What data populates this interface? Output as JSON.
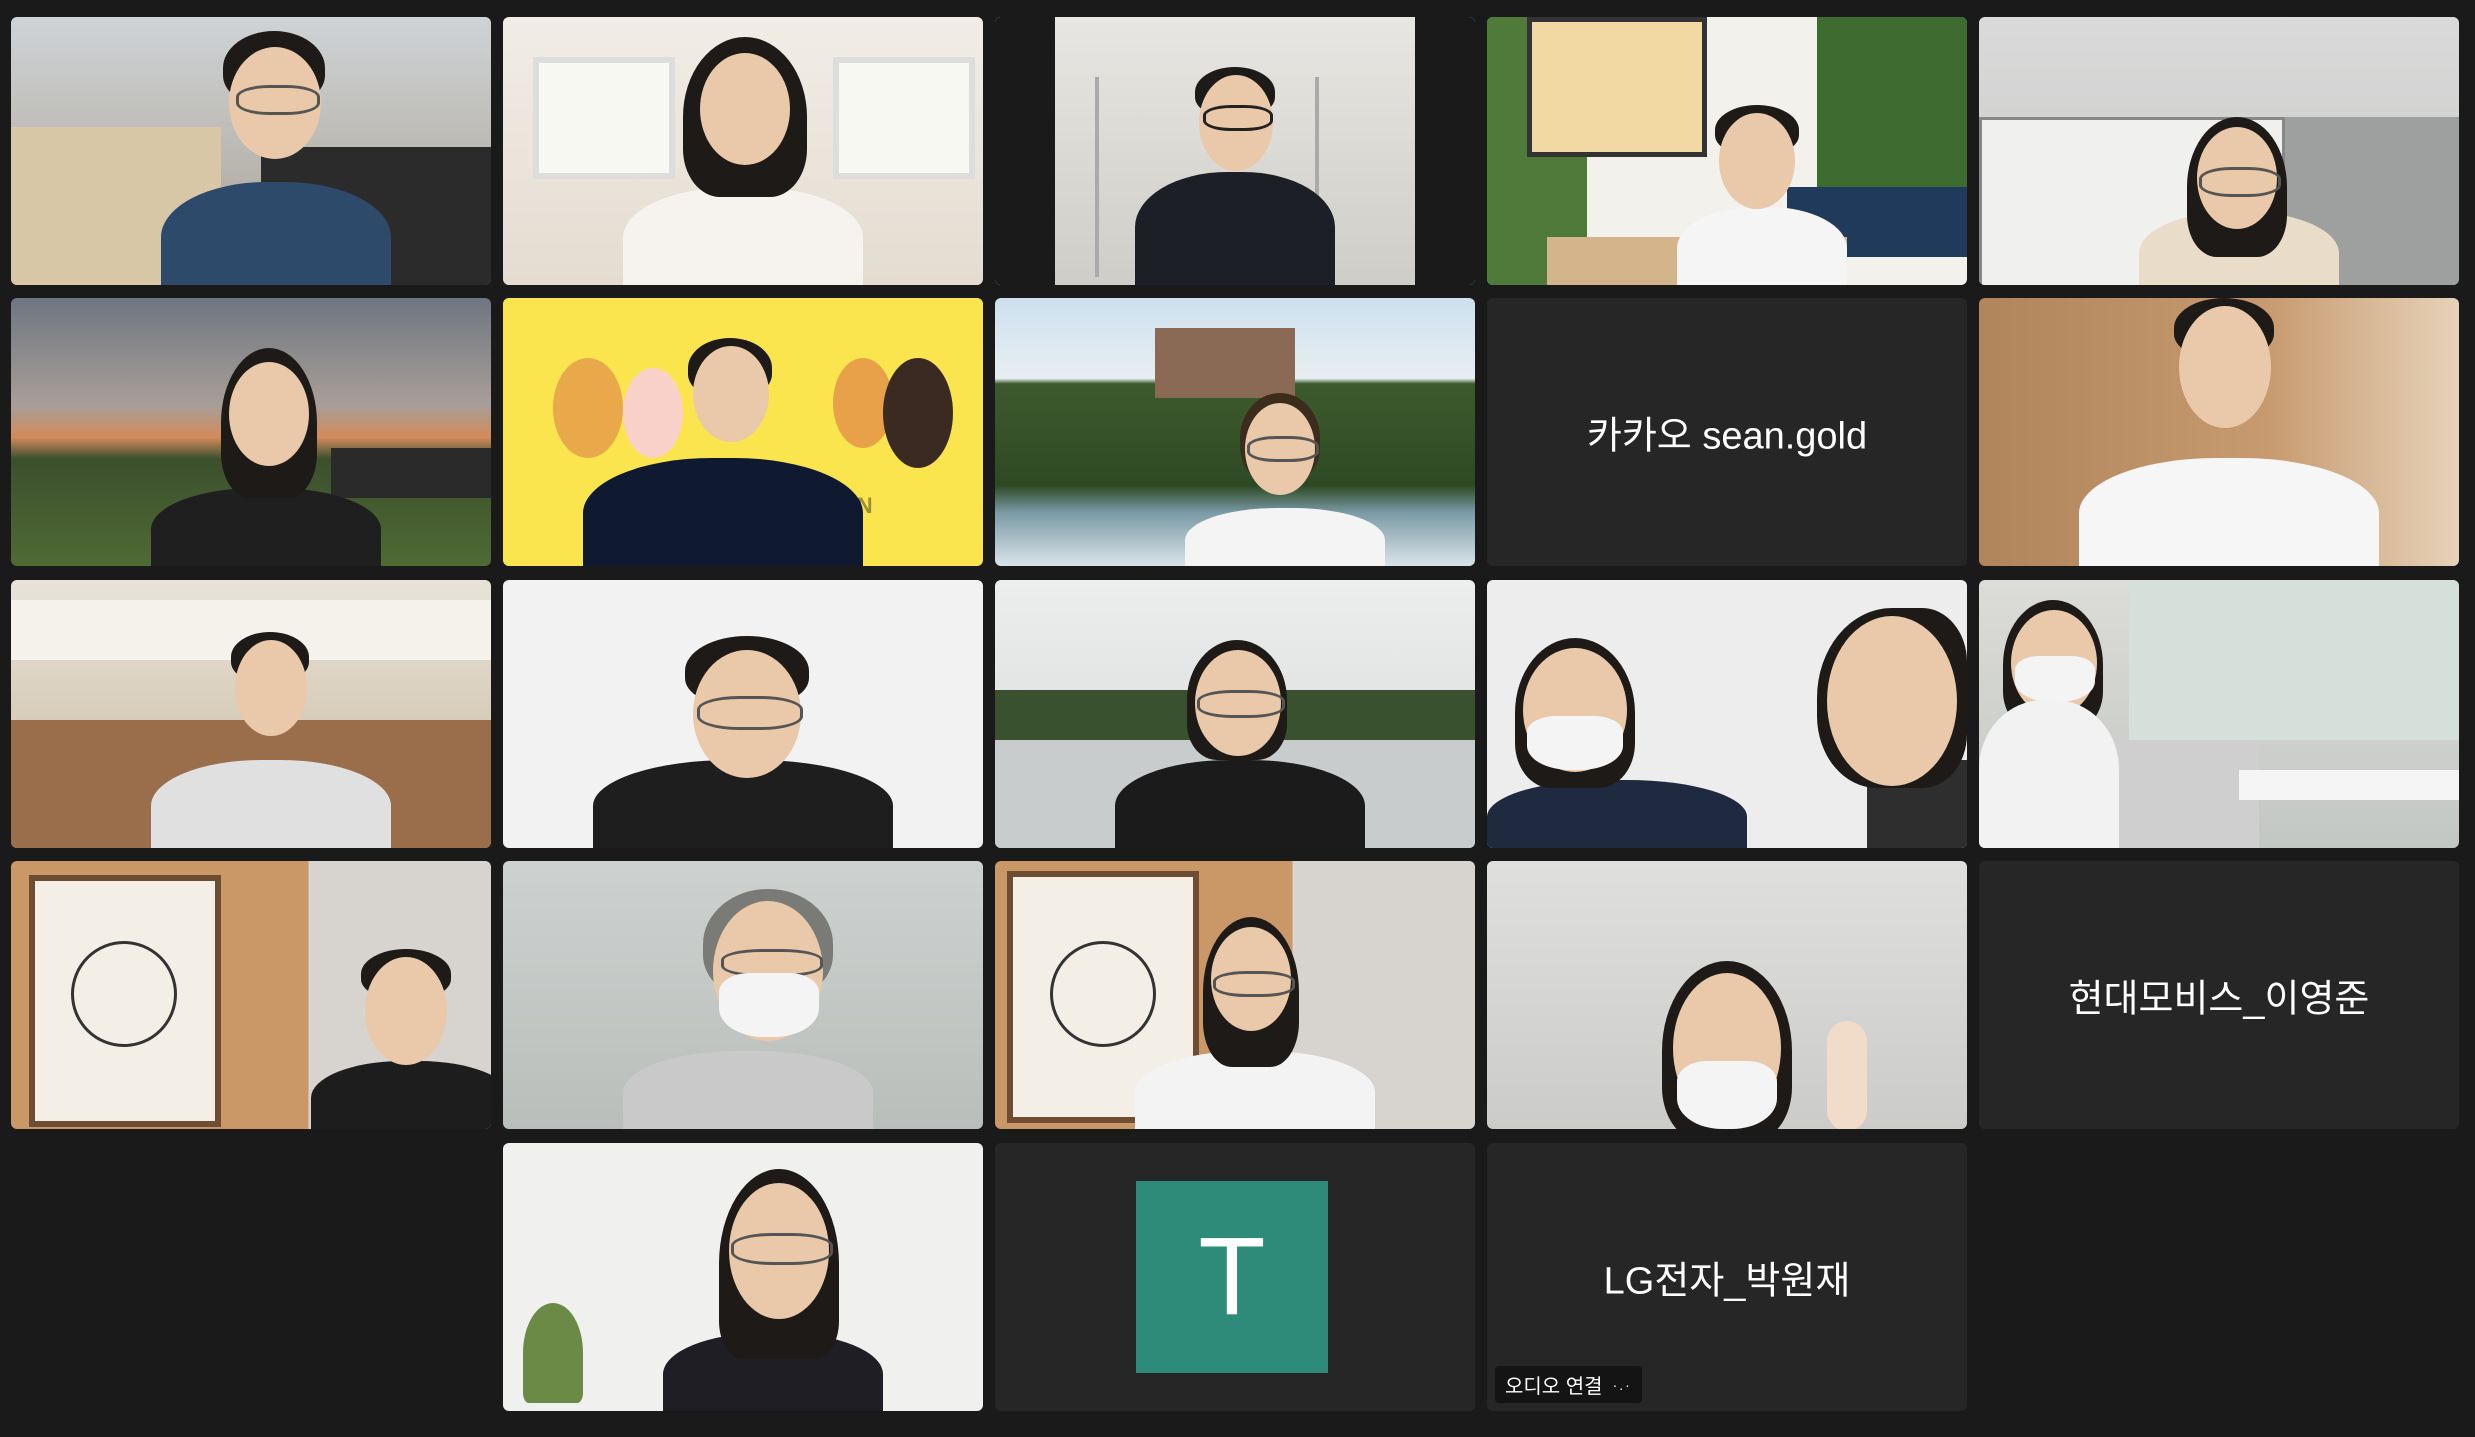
{
  "app": {
    "view": "gallery"
  },
  "tiles": [
    {
      "id": "p1"
    },
    {
      "id": "p2"
    },
    {
      "id": "p3",
      "active": true
    },
    {
      "id": "p4"
    },
    {
      "id": "p5"
    },
    {
      "id": "p6"
    },
    {
      "id": "p7",
      "background_text": "CHAIN"
    },
    {
      "id": "p8"
    },
    {
      "id": "p9",
      "label": "카카오 sean.gold",
      "video": false
    },
    {
      "id": "p10"
    },
    {
      "id": "p11"
    },
    {
      "id": "p12"
    },
    {
      "id": "p13"
    },
    {
      "id": "p14"
    },
    {
      "id": "p15"
    },
    {
      "id": "p16"
    },
    {
      "id": "p17"
    },
    {
      "id": "p18"
    },
    {
      "id": "p19"
    },
    {
      "id": "p20",
      "label": "현대모비스_이영준",
      "video": false
    },
    {
      "id": "p21"
    },
    {
      "id": "p22",
      "avatar_letter": "T",
      "avatar_color": "#2e8b7a",
      "video": false
    },
    {
      "id": "p23",
      "label": "LG전자_박원재",
      "video": false,
      "status": "오디오 연결",
      "status_icon": "connecting-dots-icon"
    }
  ],
  "colors": {
    "background": "#1a1a1a",
    "tile": "#262626",
    "active_speaker_border": "#3bd16f"
  }
}
